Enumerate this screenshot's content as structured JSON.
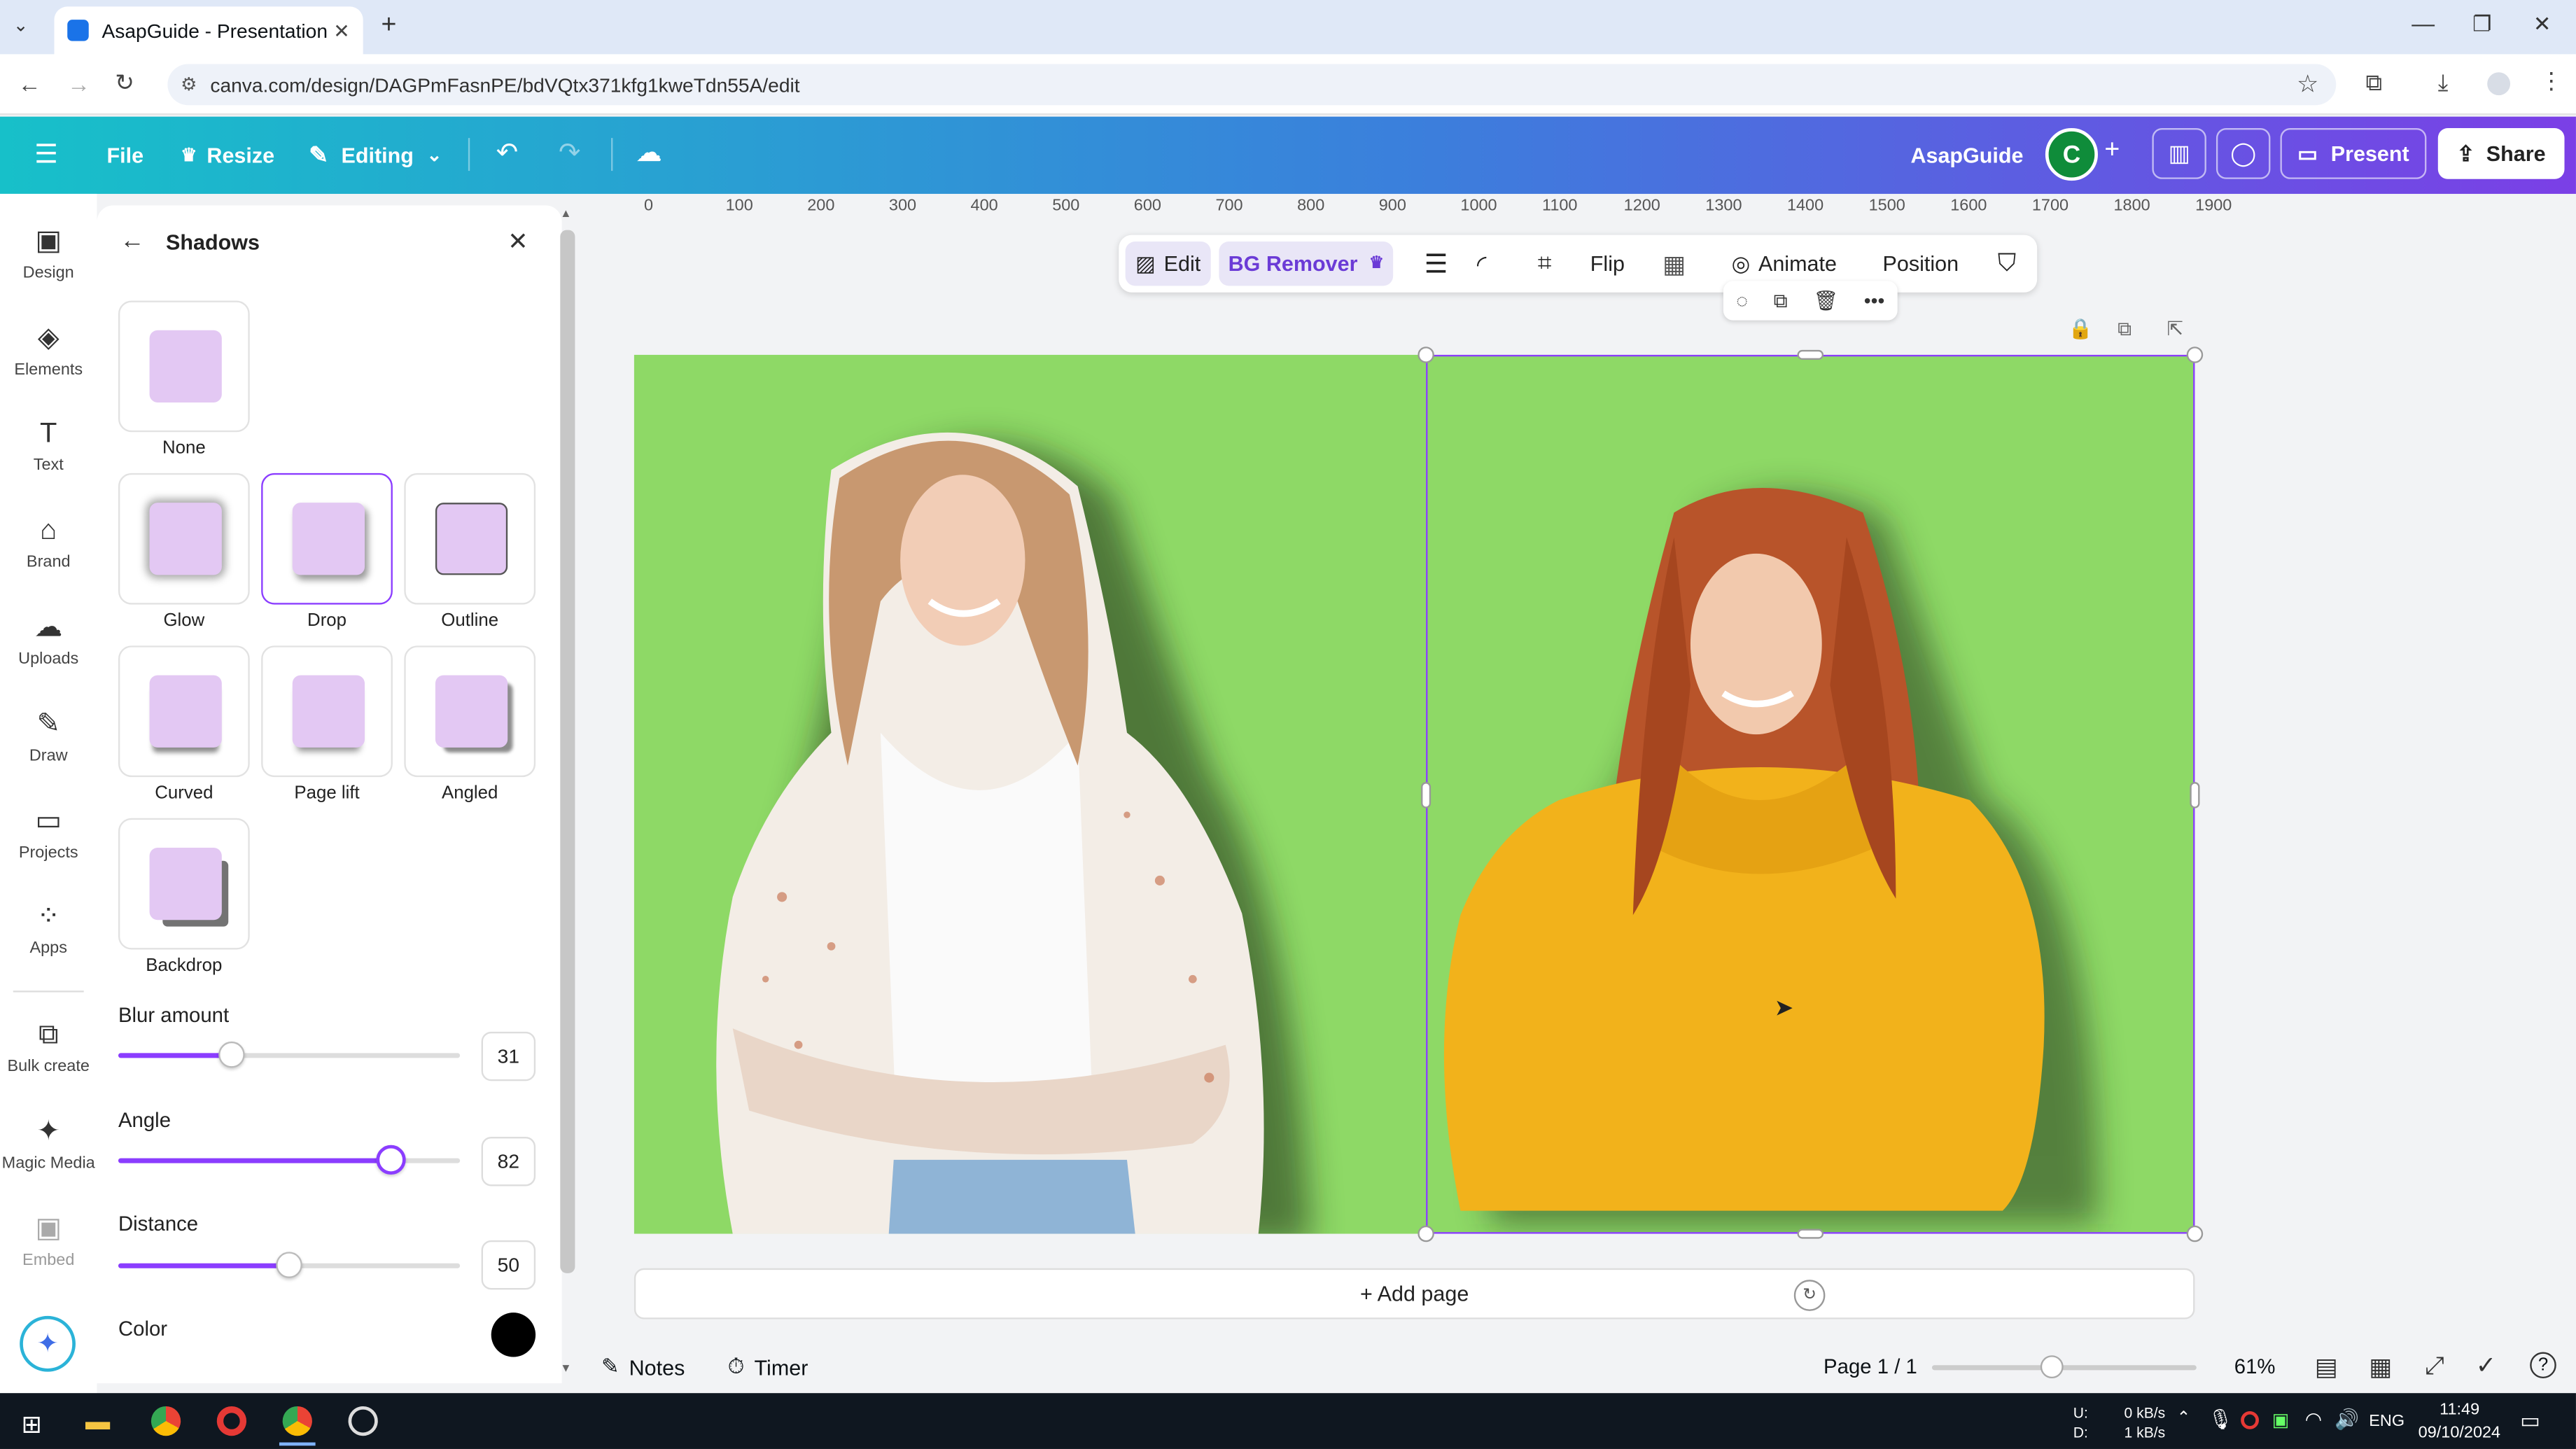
{
  "browser": {
    "tab_title": "AsapGuide - Presentation",
    "url": "canva.com/design/DAGPmFasnPE/bdVQtx371kfg1kweTdn55A/edit"
  },
  "header": {
    "file": "File",
    "resize": "Resize",
    "editing": "Editing",
    "brand_name": "AsapGuide",
    "avatar_letter": "C",
    "present": "Present",
    "share": "Share"
  },
  "rail": {
    "items": [
      "Design",
      "Elements",
      "Text",
      "Brand",
      "Uploads",
      "Draw",
      "Projects",
      "Apps",
      "Bulk create",
      "Magic Media",
      "Embed"
    ]
  },
  "panel": {
    "title": "Shadows",
    "presets": [
      "None",
      "Glow",
      "Drop",
      "Outline",
      "Curved",
      "Page lift",
      "Angled",
      "Backdrop"
    ],
    "selected": "Drop",
    "blur": {
      "label": "Blur amount",
      "value": "31",
      "fraction": 0.33
    },
    "angle": {
      "label": "Angle",
      "value": "82",
      "fraction": 0.8
    },
    "distance": {
      "label": "Distance",
      "value": "50",
      "fraction": 0.5
    },
    "color": {
      "label": "Color",
      "value": "#000000"
    }
  },
  "ruler": [
    "0",
    "100",
    "200",
    "300",
    "400",
    "500",
    "600",
    "700",
    "800",
    "900",
    "1000",
    "1100",
    "1200",
    "1300",
    "1400",
    "1500",
    "1600",
    "1700",
    "1800",
    "1900"
  ],
  "toolbar": {
    "edit": "Edit",
    "bg_remover": "BG Remover",
    "flip": "Flip",
    "animate": "Animate",
    "position": "Position"
  },
  "canvas": {
    "background": "#8ed966",
    "add_page": "+ Add page"
  },
  "footer": {
    "notes": "Notes",
    "timer": "Timer",
    "page": "Page 1 / 1",
    "zoom": "61%"
  },
  "taskbar": {
    "net_up": "0 kB/s",
    "net_down": "1 kB/s",
    "net_u": "U:",
    "net_d": "D:",
    "lang": "ENG",
    "time": "11:49",
    "date": "09/10/2024"
  }
}
